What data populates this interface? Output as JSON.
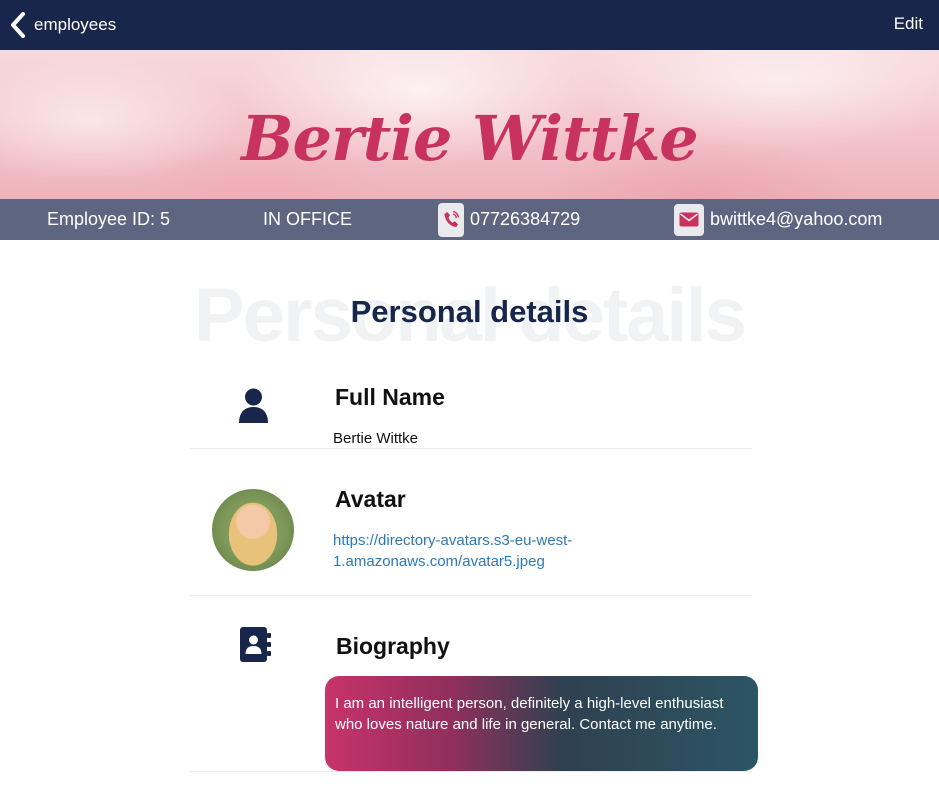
{
  "nav": {
    "back_label": "employees",
    "edit_label": "Edit"
  },
  "hero": {
    "name": "Bertie Wittke"
  },
  "info": {
    "employee_id": "Employee ID: 5",
    "status": "IN OFFICE",
    "phone": "07726384729",
    "email": "bwittke4@yahoo.com"
  },
  "section": {
    "title": "Personal details",
    "watermark": "Personal details"
  },
  "details": {
    "full_name": {
      "heading": "Full Name",
      "value": "Bertie Wittke"
    },
    "avatar": {
      "heading": "Avatar",
      "url": "https://directory-avatars.s3-eu-west-1.amazonaws.com/avatar5.jpeg"
    },
    "biography": {
      "heading": "Biography",
      "text": "I am an intelligent person, definitely a high-level enthusiast who loves nature and life in general. Contact me anytime."
    }
  },
  "colors": {
    "navy": "#17264a",
    "brand_pink": "#c8325f",
    "link": "#2a7ab8",
    "info_bar": "#5e6580"
  },
  "icons": {
    "back": "chevron-left-icon",
    "phone": "phone-icon",
    "email": "envelope-icon",
    "person": "user-icon",
    "contact_book": "address-book-icon"
  }
}
